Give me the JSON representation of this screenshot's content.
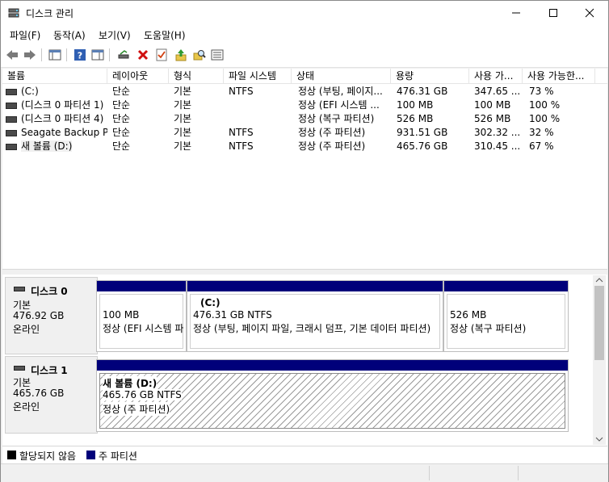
{
  "window": {
    "title": "디스크 관리"
  },
  "menu": [
    "파일(F)",
    "동작(A)",
    "보기(V)",
    "도움말(H)"
  ],
  "columns": [
    "볼륨",
    "레이아웃",
    "형식",
    "파일 시스템",
    "상태",
    "용량",
    "사용 가...",
    "사용 가능한..."
  ],
  "rows": [
    {
      "volume": "(C:)",
      "layout": "단순",
      "type": "기본",
      "fs": "NTFS",
      "status": "정상 (부팅, 페이지...",
      "capacity": "476.31 GB",
      "free": "347.65 ...",
      "pct": "73 %"
    },
    {
      "volume": "(디스크 0 파티션 1)",
      "layout": "단순",
      "type": "기본",
      "fs": "",
      "status": "정상 (EFI 시스템 ...",
      "capacity": "100 MB",
      "free": "100 MB",
      "pct": "100 %"
    },
    {
      "volume": "(디스크 0 파티션 4)",
      "layout": "단순",
      "type": "기본",
      "fs": "",
      "status": "정상 (복구 파티션)",
      "capacity": "526 MB",
      "free": "526 MB",
      "pct": "100 %"
    },
    {
      "volume": "Seagate Backup P...",
      "layout": "단순",
      "type": "기본",
      "fs": "NTFS",
      "status": "정상 (주 파티션)",
      "capacity": "931.51 GB",
      "free": "302.32 ...",
      "pct": "32 %"
    },
    {
      "volume": "새 볼륨 (D:)",
      "layout": "단순",
      "type": "기본",
      "fs": "NTFS",
      "status": "정상 (주 파티션)",
      "capacity": "465.76 GB",
      "free": "310.45 ...",
      "pct": "67 %"
    }
  ],
  "disks": [
    {
      "name": "디스크 0",
      "type": "기본",
      "size": "476.92 GB",
      "state": "온라인",
      "partitions": [
        {
          "title": "",
          "size": "100 MB",
          "status": "정상 (EFI 시스템 파"
        },
        {
          "title": "(C:)",
          "size": "476.31 GB NTFS",
          "status": "정상 (부팅, 페이지 파일, 크래시 덤프, 기본 데이터 파티션)"
        },
        {
          "title": "",
          "size": "526 MB",
          "status": "정상 (복구 파티션)"
        }
      ]
    },
    {
      "name": "디스크 1",
      "type": "기본",
      "size": "465.76 GB",
      "state": "온라인",
      "partitions": [
        {
          "title": "새 볼륨  (D:)",
          "size": "465.76 GB NTFS",
          "status": "정상 (주 파티션)"
        }
      ]
    }
  ],
  "legend": {
    "unallocated": "할당되지 않음",
    "primary": "주 파티션"
  },
  "colors": {
    "primary": "#00007a",
    "unallocated": "#000000",
    "accent": "#0078d7"
  }
}
